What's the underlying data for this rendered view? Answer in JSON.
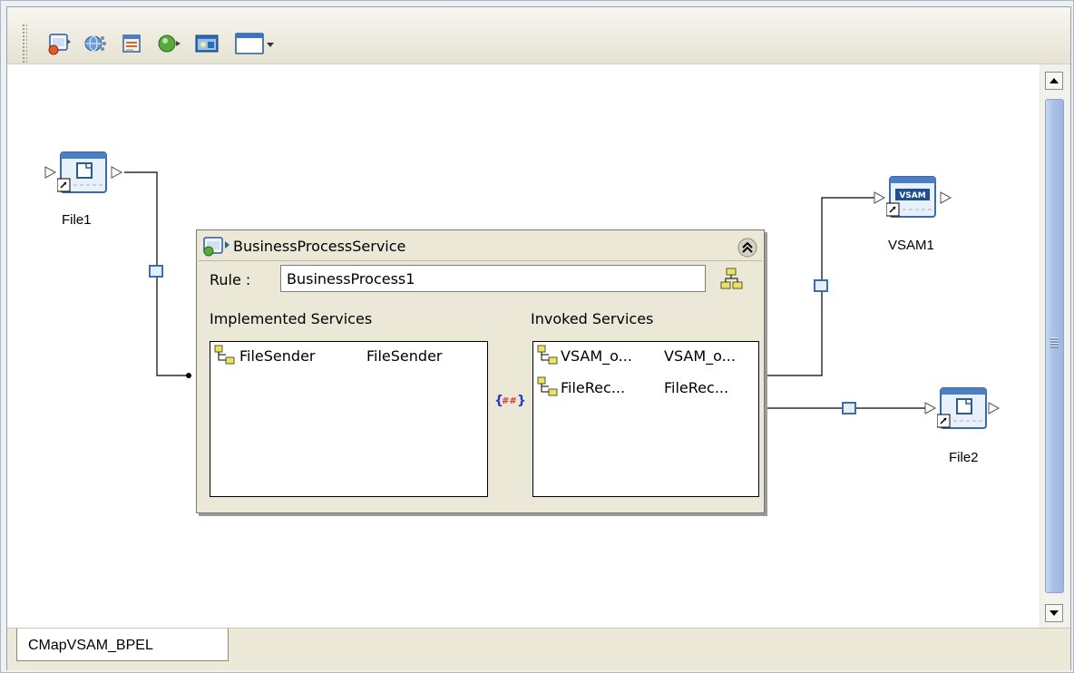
{
  "editor": {
    "tab_label": "CMapVSAM_BPEL"
  },
  "toolbar": {
    "buttons": [
      {
        "icon": "service-icon"
      },
      {
        "icon": "web-service-icon"
      },
      {
        "icon": "process-icon"
      },
      {
        "icon": "database-icon"
      },
      {
        "icon": "external-app-icon"
      },
      {
        "icon": "window-dropdown-icon"
      }
    ]
  },
  "nodes": {
    "file1": {
      "label": "File1"
    },
    "vsam1": {
      "label": "VSAM1",
      "badge": "VSAM"
    },
    "file2": {
      "label": "File2"
    }
  },
  "service": {
    "title": "BusinessProcessService",
    "rule_label": "Rule :",
    "rule_value": "BusinessProcess1",
    "implemented_header": "Implemented Services",
    "invoked_header": "Invoked Services",
    "implemented": [
      {
        "name": "FileSender",
        "value": "FileSender"
      }
    ],
    "invoked": [
      {
        "name": "VSAM_o...",
        "value": "VSAM_o..."
      },
      {
        "name": "FileRec...",
        "value": "FileRec..."
      }
    ]
  },
  "colors": {
    "scroll_thumb": "#a9c0e6",
    "node_blue": "#3c74b8",
    "link_blue": "#3d6ea8"
  }
}
